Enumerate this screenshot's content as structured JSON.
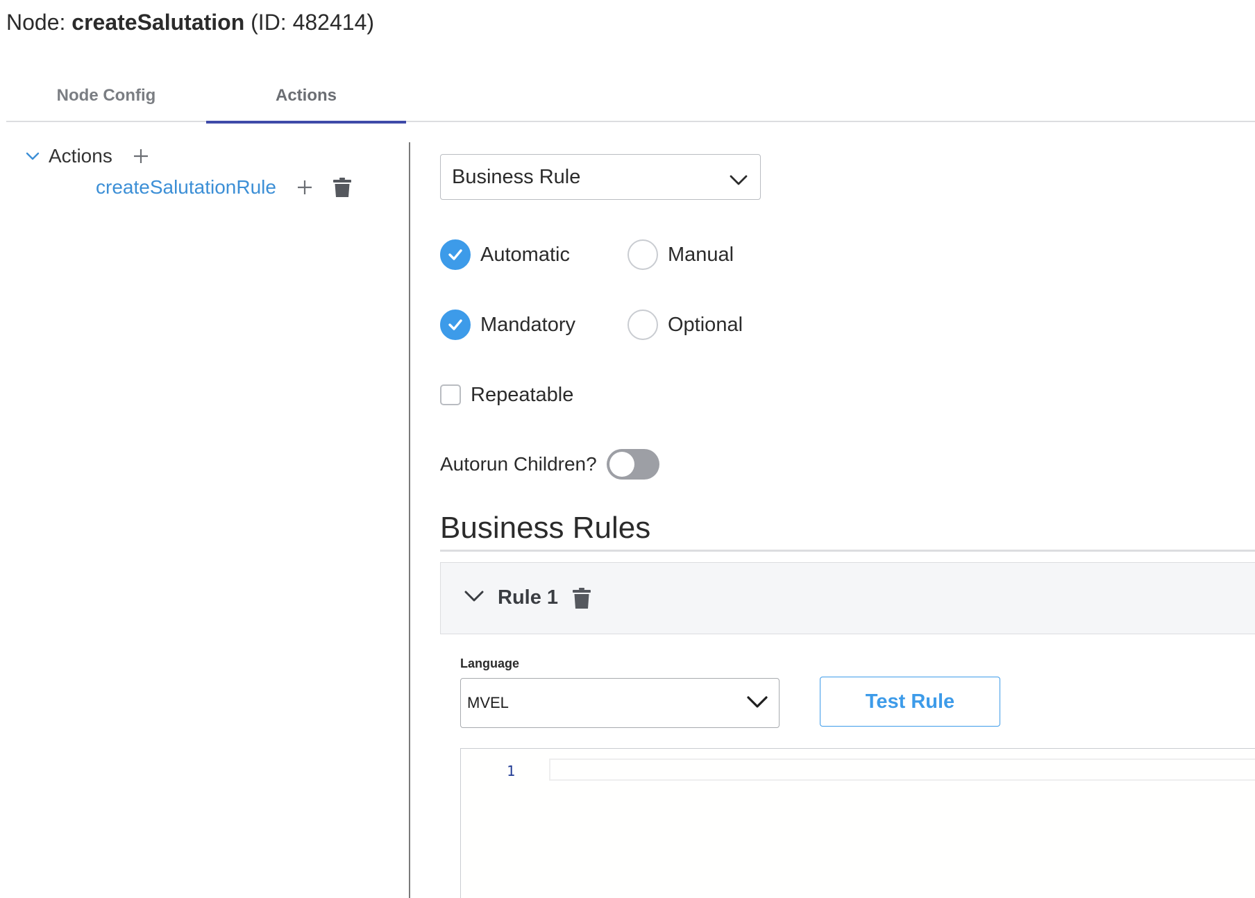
{
  "header": {
    "prefix": "Node: ",
    "node_name": "createSalutation",
    "id_text": " (ID: 482414)"
  },
  "tabs": [
    {
      "label": "Node Config",
      "active": false
    },
    {
      "label": "Actions",
      "active": true
    }
  ],
  "sidebar": {
    "root": {
      "label": "Actions",
      "expanded": true
    },
    "children": [
      {
        "label": "createSalutationRule"
      }
    ]
  },
  "form": {
    "action_type": "Business Rule",
    "trigger": {
      "options": [
        {
          "label": "Automatic",
          "checked": true
        },
        {
          "label": "Manual",
          "checked": false
        }
      ]
    },
    "requirement": {
      "options": [
        {
          "label": "Mandatory",
          "checked": true
        },
        {
          "label": "Optional",
          "checked": false
        }
      ]
    },
    "repeatable": {
      "label": "Repeatable",
      "checked": false
    },
    "autorun": {
      "label": "Autorun Children?",
      "on": false
    }
  },
  "rules_section": {
    "title": "Business Rules",
    "rules": [
      {
        "title": "Rule 1",
        "expanded": true,
        "language_label": "Language",
        "language_value": "MVEL",
        "test_button": "Test Rule",
        "editor_line_numbers": [
          "1"
        ]
      }
    ]
  },
  "colors": {
    "accent_blue": "#3d9be9",
    "tab_indicator": "#3f4aa8",
    "link_blue": "#3c8fd6",
    "toggle_off": "#9d9fa5"
  },
  "icons": {
    "tree_expand": "chevron-down-icon",
    "add": "plus-icon",
    "delete": "trash-icon",
    "dropdown": "chevron-down-icon",
    "radio_checked": "checkmark-icon"
  }
}
